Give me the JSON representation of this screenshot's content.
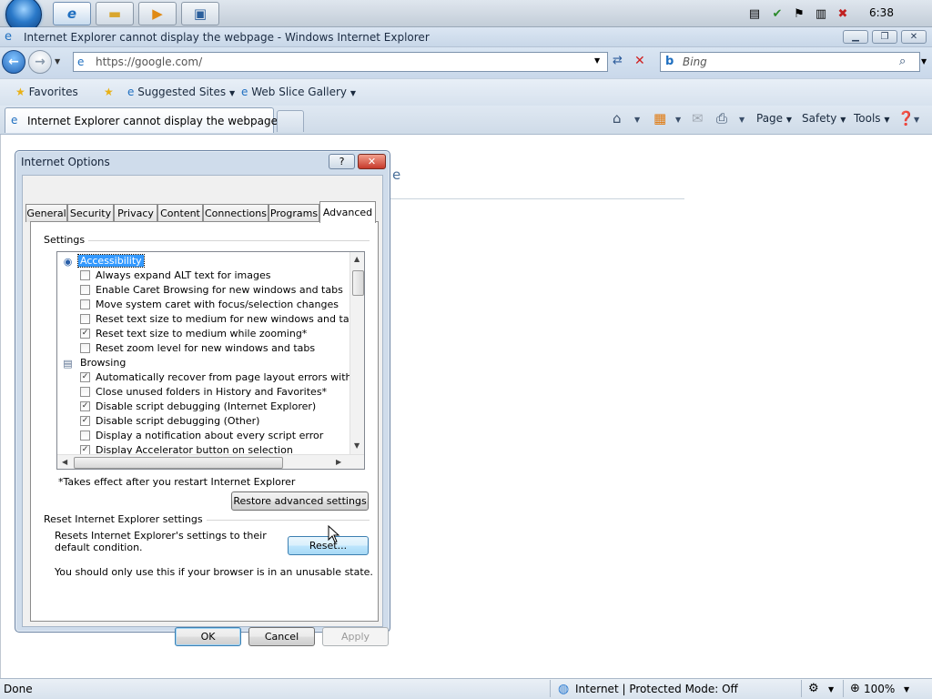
{
  "taskbar": {
    "clock": "6:38",
    "buttons": [
      {
        "name": "ie-taskbar-button",
        "icon": "ie-icon",
        "glyph": "e",
        "active": true
      },
      {
        "name": "explorer-taskbar-button",
        "icon": "folder-icon",
        "glyph": "▬"
      },
      {
        "name": "media-player-taskbar-button",
        "icon": "media-player-icon",
        "glyph": "▶"
      },
      {
        "name": "remote-desktop-taskbar-button",
        "icon": "monitor-icon",
        "glyph": "▣"
      }
    ]
  },
  "window": {
    "title": "Internet Explorer cannot display the webpage - Windows Internet Explorer"
  },
  "address_bar": {
    "url": "https://google.com/",
    "search_placeholder": "Bing"
  },
  "favorites_bar": {
    "favorites_label": "Favorites",
    "suggested_sites": "Suggested Sites",
    "web_slice_gallery": "Web Slice Gallery"
  },
  "tab": {
    "title": "Internet Explorer cannot display the webpage"
  },
  "command_bar": {
    "page": "Page",
    "safety": "Safety",
    "tools": "Tools"
  },
  "page": {
    "heading_fragment": "e"
  },
  "status_bar": {
    "status": "Done",
    "zone": "Internet | Protected Mode: Off",
    "zoom": "100%"
  },
  "dialog": {
    "title": "Internet Options",
    "tabs": [
      "General",
      "Security",
      "Privacy",
      "Content",
      "Connections",
      "Programs",
      "Advanced"
    ],
    "selected_tab": "Advanced",
    "settings_group_label": "Settings",
    "settings": [
      {
        "type": "category",
        "label": "Accessibility",
        "selected": true,
        "icon": "accessibility-icon"
      },
      {
        "type": "checkbox",
        "label": "Always expand ALT text for images",
        "checked": false
      },
      {
        "type": "checkbox",
        "label": "Enable Caret Browsing for new windows and tabs",
        "checked": false
      },
      {
        "type": "checkbox",
        "label": "Move system caret with focus/selection changes",
        "checked": false
      },
      {
        "type": "checkbox",
        "label": "Reset text size to medium for new windows and tabs",
        "checked": false
      },
      {
        "type": "checkbox",
        "label": "Reset text size to medium while zooming*",
        "checked": true
      },
      {
        "type": "checkbox",
        "label": "Reset zoom level for new windows and tabs",
        "checked": false
      },
      {
        "type": "category",
        "label": "Browsing",
        "selected": false,
        "icon": "browsing-icon"
      },
      {
        "type": "checkbox",
        "label": "Automatically recover from page layout errors with Compa",
        "checked": true
      },
      {
        "type": "checkbox",
        "label": "Close unused folders in History and Favorites*",
        "checked": false
      },
      {
        "type": "checkbox",
        "label": "Disable script debugging (Internet Explorer)",
        "checked": true
      },
      {
        "type": "checkbox",
        "label": "Disable script debugging (Other)",
        "checked": true
      },
      {
        "type": "checkbox",
        "label": "Display a notification about every script error",
        "checked": false
      },
      {
        "type": "checkbox",
        "label": "Display Accelerator button on selection",
        "checked": true
      }
    ],
    "restart_note": "*Takes effect after you restart Internet Explorer",
    "restore_button": "Restore advanced settings",
    "reset_group_label": "Reset Internet Explorer settings",
    "reset_description": "Resets Internet Explorer's settings to their default condition.",
    "reset_button": "Reset...",
    "reset_warning": "You should only use this if your browser is in an unusable state.",
    "ok_button": "OK",
    "cancel_button": "Cancel",
    "apply_button": "Apply"
  }
}
